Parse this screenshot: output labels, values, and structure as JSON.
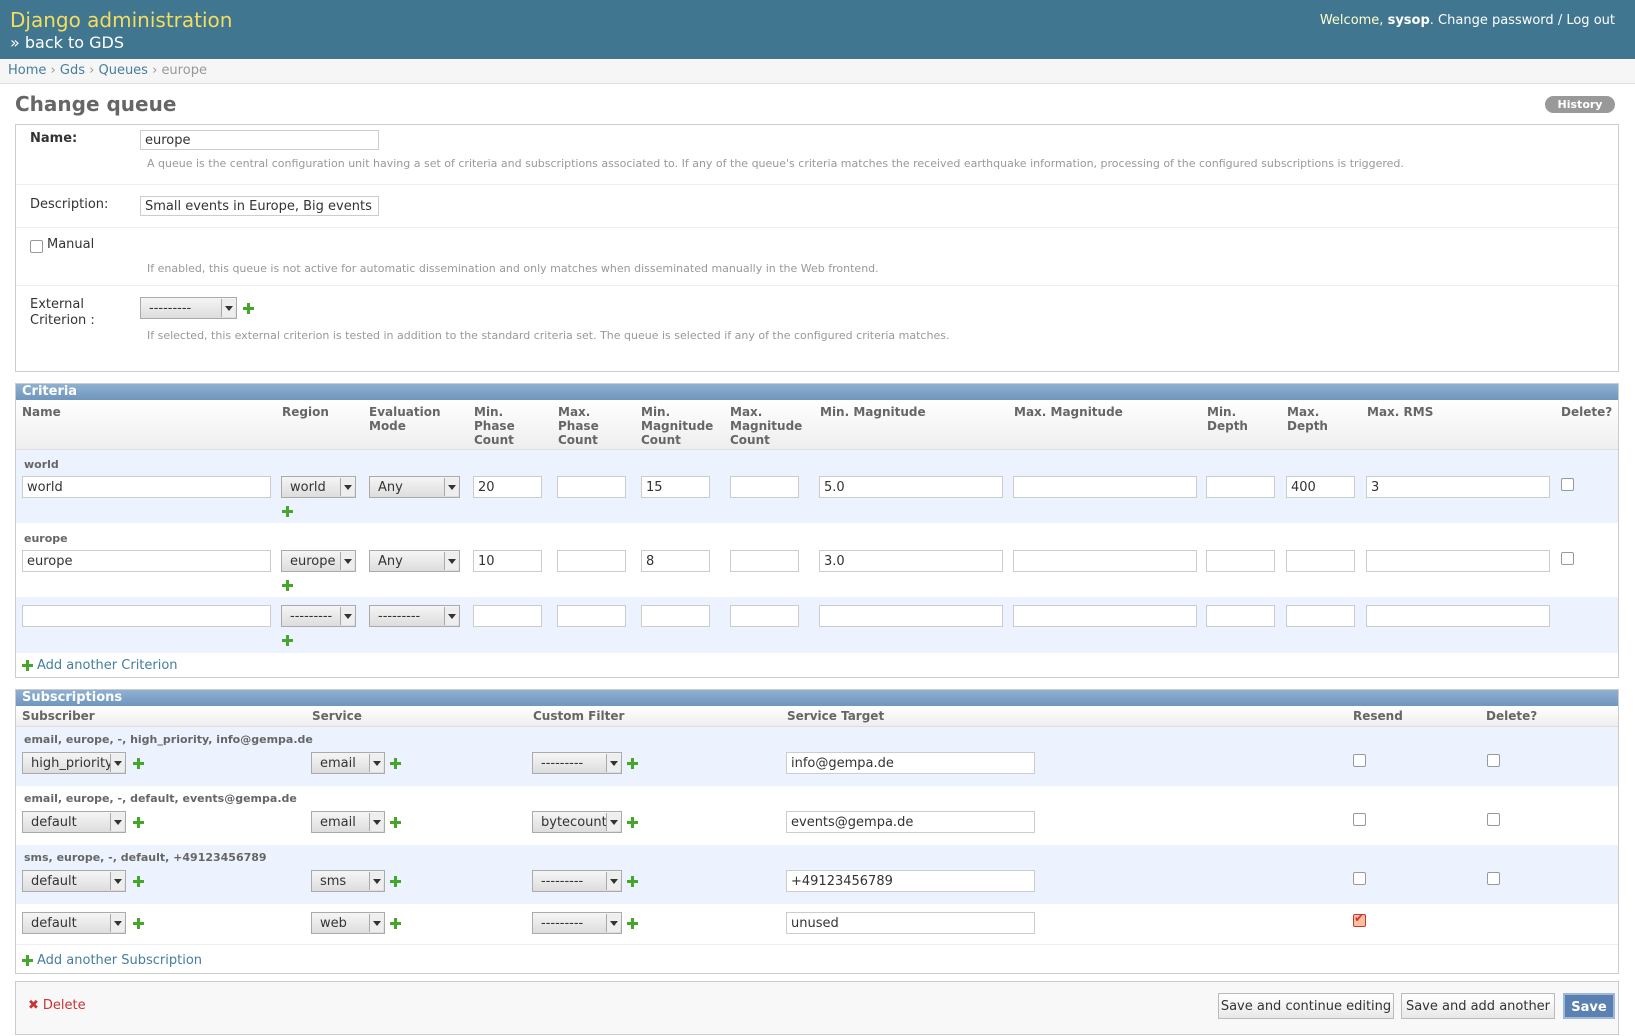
{
  "header": {
    "site_name": "Django administration",
    "back_link": "» back to GDS",
    "welcome": "Welcome,",
    "user": "sysop",
    "change_password": "Change password",
    "sep": "/",
    "logout": "Log out"
  },
  "breadcrumbs": {
    "home": "Home",
    "gds": "Gds",
    "queues": "Queues",
    "current": "europe",
    "sep": "›"
  },
  "page": {
    "title": "Change queue",
    "history": "History"
  },
  "form": {
    "name_label": "Name:",
    "name_value": "europe",
    "name_help": "A queue is the central configuration unit having a set of criteria and subscriptions associated to. If any of the queue's criteria matches the received earthquake information, processing of the configured subscriptions is triggered.",
    "description_label": "Description:",
    "description_value": "Small events in Europe, Big events worl",
    "manual_label": "Manual",
    "manual_help": "If enabled, this queue is not active for automatic dissemination and only matches when disseminated manually in the Web frontend.",
    "external_label_1": "External",
    "external_label_2": "Criterion :",
    "external_value": "---------",
    "external_help": "If selected, this external criterion is tested in addition to the standard criteria set. The queue is selected if any of the configured criteria matches."
  },
  "criteria": {
    "title": "Criteria",
    "headers": [
      "Name",
      "Region",
      "Evaluation\nMode",
      "Min.\nPhase\nCount",
      "Max.\nPhase\nCount",
      "Min.\nMagnitude\nCount",
      "Max.\nMagnitude\nCount",
      "Min. Magnitude",
      "Max. Magnitude",
      "Min.\nDepth",
      "Max.\nDepth",
      "Max. RMS",
      "Delete?"
    ],
    "rows": [
      {
        "title": "world",
        "name": "world",
        "region": "world",
        "mode": "Any",
        "min_phase": "20",
        "max_phase": "",
        "min_mag_count": "15",
        "max_mag_count": "",
        "min_mag": "5.0",
        "max_mag": "",
        "min_depth": "",
        "max_depth": "400",
        "max_rms": "3"
      },
      {
        "title": "europe",
        "name": "europe",
        "region": "europe",
        "mode": "Any",
        "min_phase": "10",
        "max_phase": "",
        "min_mag_count": "8",
        "max_mag_count": "",
        "min_mag": "3.0",
        "max_mag": "",
        "min_depth": "",
        "max_depth": "",
        "max_rms": ""
      },
      {
        "title": "",
        "name": "",
        "region": "---------",
        "mode": "---------",
        "min_phase": "",
        "max_phase": "",
        "min_mag_count": "",
        "max_mag_count": "",
        "min_mag": "",
        "max_mag": "",
        "min_depth": "",
        "max_depth": "",
        "max_rms": ""
      }
    ],
    "add_another": "Add another Criterion"
  },
  "subscriptions": {
    "title": "Subscriptions",
    "headers": [
      "Subscriber",
      "Service",
      "Custom Filter",
      "Service Target",
      "Resend",
      "Delete?"
    ],
    "rows": [
      {
        "title": "email, europe, -, high_priority, info@gempa.de",
        "subscriber": "high_priority",
        "service": "email",
        "filter": "---------",
        "target": "info@gempa.de",
        "resend": false
      },
      {
        "title": "email, europe, -, default, events@gempa.de",
        "subscriber": "default",
        "service": "email",
        "filter": "bytecount",
        "target": "events@gempa.de",
        "resend": false
      },
      {
        "title": "sms, europe, -, default, +49123456789",
        "subscriber": "default",
        "service": "sms",
        "filter": "---------",
        "target": "+49123456789",
        "resend": false
      },
      {
        "title": "",
        "subscriber": "default",
        "service": "web",
        "filter": "---------",
        "target": "unused",
        "resend": true
      }
    ],
    "add_another": "Add another Subscription"
  },
  "submit": {
    "delete": "Delete",
    "delete_icon": "x-icon",
    "save_continue": "Save and continue editing",
    "save_add": "Save and add another",
    "save": "Save"
  },
  "colors": {
    "header_bg": "#417690",
    "site_name": "#f5dd5d",
    "link": "#447e9b",
    "module_header": "#7ca0c7",
    "alt_row": "#edf3fe",
    "delete": "#cc3333",
    "save_button": "#5b80b2",
    "add_icon": "#44a72b"
  }
}
